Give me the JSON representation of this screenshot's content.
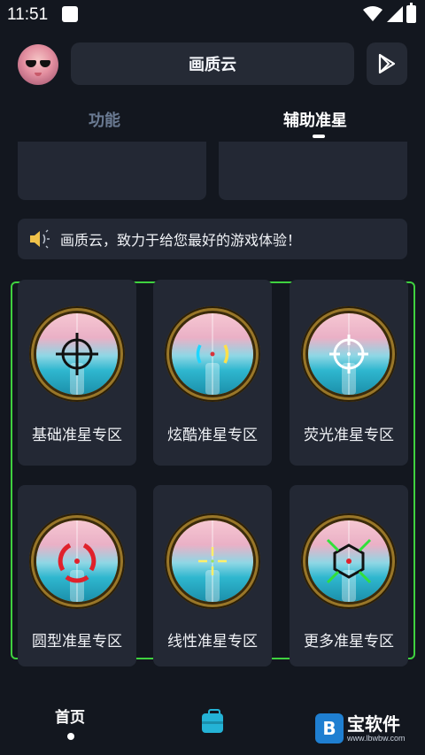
{
  "status_bar": {
    "time": "11:51"
  },
  "header": {
    "title": "画质云"
  },
  "tabs": [
    {
      "label": "功能",
      "active": false
    },
    {
      "label": "辅助准星",
      "active": true
    }
  ],
  "notice": {
    "text": "画质云，致力于给您最好的游戏体验！"
  },
  "crosshair_cards": [
    {
      "label": "基础准星专区",
      "icon": "classic-crosshair-icon"
    },
    {
      "label": "炫酷准星专区",
      "icon": "bracket-crosshair-icon"
    },
    {
      "label": "荧光准星专区",
      "icon": "glow-crosshair-icon"
    },
    {
      "label": "圆型准星专区",
      "icon": "ring-crosshair-icon"
    },
    {
      "label": "线性准星专区",
      "icon": "line-crosshair-icon"
    },
    {
      "label": "更多准星专区",
      "icon": "hexagon-crosshair-icon"
    }
  ],
  "bottom_nav": {
    "home_label": "首页"
  },
  "watermark": {
    "name": "宝软件",
    "url": "www.lbwbw.com"
  },
  "colors": {
    "background": "#13171f",
    "card": "#232834",
    "frame_green": "#3fd13f",
    "tab_inactive": "#6a7a92"
  }
}
